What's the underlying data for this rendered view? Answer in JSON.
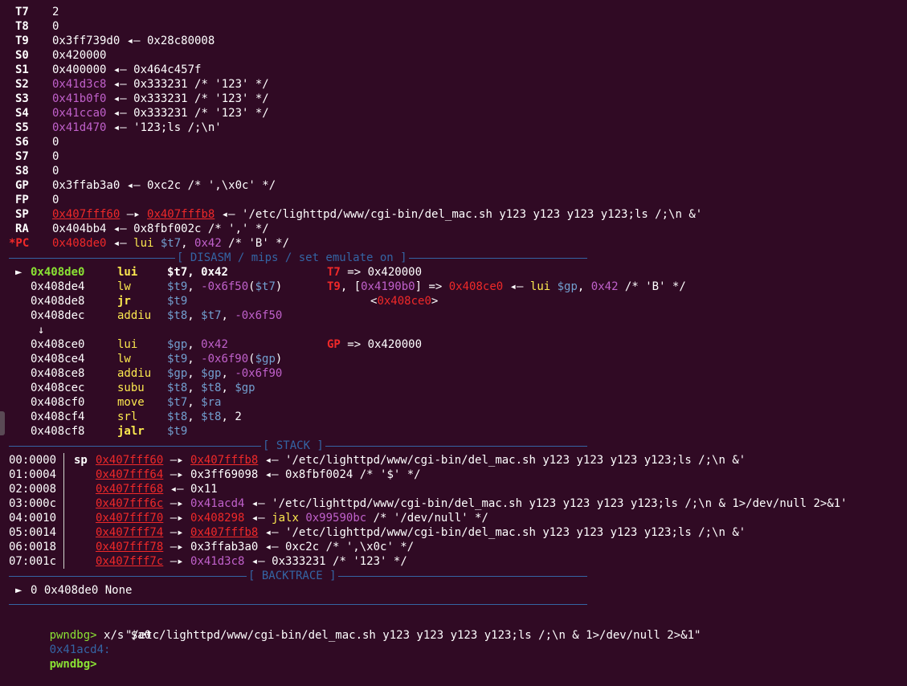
{
  "registers": [
    {
      "name": "T7",
      "parts": [
        [
          "w",
          "2"
        ]
      ]
    },
    {
      "name": "T8",
      "parts": [
        [
          "w",
          "0"
        ]
      ]
    },
    {
      "name": "T9",
      "parts": [
        [
          "w",
          "0x3ff739d0 ◂— 0x28c80008"
        ]
      ]
    },
    {
      "name": "S0",
      "parts": [
        [
          "w",
          "0x420000"
        ]
      ]
    },
    {
      "name": "S1",
      "parts": [
        [
          "w",
          "0x400000 ◂— 0x464c457f"
        ]
      ]
    },
    {
      "name": "S2",
      "parts": [
        [
          "m",
          "0x41d3c8"
        ],
        [
          "w",
          " ◂— 0x333231 /* '123' */"
        ]
      ]
    },
    {
      "name": "S3",
      "parts": [
        [
          "m",
          "0x41b0f0"
        ],
        [
          "w",
          " ◂— 0x333231 /* '123' */"
        ]
      ]
    },
    {
      "name": "S4",
      "parts": [
        [
          "m",
          "0x41cca0"
        ],
        [
          "w",
          " ◂— 0x333231 /* '123' */"
        ]
      ]
    },
    {
      "name": "S5",
      "parts": [
        [
          "m",
          "0x41d470"
        ],
        [
          "w",
          " ◂— '123;ls /;\\n'"
        ]
      ]
    },
    {
      "name": "S6",
      "parts": [
        [
          "w",
          "0"
        ]
      ]
    },
    {
      "name": "S7",
      "parts": [
        [
          "w",
          "0"
        ]
      ]
    },
    {
      "name": "S8",
      "parts": [
        [
          "w",
          "0"
        ]
      ]
    },
    {
      "name": "GP",
      "parts": [
        [
          "w",
          "0x3ffab3a0 ◂— 0xc2c /* ',\\x0c' */"
        ]
      ]
    },
    {
      "name": "FP",
      "parts": [
        [
          "w",
          "0"
        ]
      ]
    },
    {
      "name": "SP",
      "parts": [
        [
          "ru",
          "0x407fff60"
        ],
        [
          "w",
          " —▸ "
        ],
        [
          "ru",
          "0x407fffb8"
        ],
        [
          "w",
          " ◂— '/etc/lighttpd/www/cgi-bin/del_mac.sh y123 y123 y123 y123;ls /;\\n &'"
        ]
      ]
    },
    {
      "name": "RA",
      "parts": [
        [
          "w",
          "0x404bb4 ◂— 0x8fbf002c /* ',' */"
        ]
      ]
    },
    {
      "name": "*PC",
      "changed": true,
      "parts": [
        [
          "r",
          "0x408de0"
        ],
        [
          "w",
          " ◂— "
        ],
        [
          "y",
          "lui "
        ],
        [
          "b",
          "$t7"
        ],
        [
          "w",
          ", "
        ],
        [
          "m",
          "0x42"
        ],
        [
          "w",
          " /* 'B' */"
        ]
      ]
    }
  ],
  "sections": {
    "disasm": "[ DISASM / mips / set emulate on ]",
    "stack": "[ STACK ]",
    "backtrace": "[ BACKTRACE ]"
  },
  "disasm": {
    "current_marker": "►",
    "branch_arrow": "↓",
    "rows": [
      {
        "current": true,
        "addr": "0x408de0",
        "mnem": "lui",
        "ops": [
          [
            "wb",
            "$t7"
          ],
          [
            "wb",
            ", "
          ],
          [
            "wb",
            "0x42"
          ]
        ],
        "note": [
          [
            "rb",
            "T7"
          ],
          [
            "w",
            " => 0x420000"
          ]
        ]
      },
      {
        "addr": "0x408de4",
        "mnem": "lw",
        "ops": [
          [
            "b",
            "$t9"
          ],
          [
            "w",
            ", "
          ],
          [
            "m",
            "-0x6f50"
          ],
          [
            "w",
            "("
          ],
          [
            "b",
            "$t7"
          ],
          [
            "w",
            ")"
          ]
        ],
        "note": [
          [
            "rb",
            "T9"
          ],
          [
            "w",
            ", ["
          ],
          [
            "m",
            "0x4190b0"
          ],
          [
            "w",
            "] => "
          ],
          [
            "r",
            "0x408ce0"
          ],
          [
            "w",
            " ◂— "
          ],
          [
            "y",
            "lui "
          ],
          [
            "b",
            "$gp"
          ],
          [
            "w",
            ", "
          ],
          [
            "m",
            "0x42"
          ],
          [
            "w",
            " /* 'B' */"
          ]
        ]
      },
      {
        "addr": "0x408de8",
        "mnem": "jr",
        "bold": true,
        "ops": [
          [
            "b",
            "$t9"
          ]
        ],
        "note": [
          [
            "w",
            "<"
          ],
          [
            "r",
            "0x408ce0"
          ],
          [
            "w",
            ">"
          ]
        ]
      },
      {
        "addr": "0x408dec",
        "mnem": "addiu",
        "ops": [
          [
            "b",
            "$t8"
          ],
          [
            "w",
            ", "
          ],
          [
            "b",
            "$t7"
          ],
          [
            "w",
            ", "
          ],
          [
            "m",
            "-0x6f50"
          ]
        ]
      },
      {
        "addr": "0x408ce0",
        "mnem": "lui",
        "ops": [
          [
            "b",
            "$gp"
          ],
          [
            "w",
            ", "
          ],
          [
            "m",
            "0x42"
          ]
        ],
        "note": [
          [
            "rb",
            "GP"
          ],
          [
            "w",
            " => 0x420000"
          ]
        ]
      },
      {
        "addr": "0x408ce4",
        "mnem": "lw",
        "ops": [
          [
            "b",
            "$t9"
          ],
          [
            "w",
            ", "
          ],
          [
            "m",
            "-0x6f90"
          ],
          [
            "w",
            "("
          ],
          [
            "b",
            "$gp"
          ],
          [
            "w",
            ")"
          ]
        ]
      },
      {
        "addr": "0x408ce8",
        "mnem": "addiu",
        "ops": [
          [
            "b",
            "$gp"
          ],
          [
            "w",
            ", "
          ],
          [
            "b",
            "$gp"
          ],
          [
            "w",
            ", "
          ],
          [
            "m",
            "-0x6f90"
          ]
        ]
      },
      {
        "addr": "0x408cec",
        "mnem": "subu",
        "ops": [
          [
            "b",
            "$t8"
          ],
          [
            "w",
            ", "
          ],
          [
            "b",
            "$t8"
          ],
          [
            "w",
            ", "
          ],
          [
            "b",
            "$gp"
          ]
        ]
      },
      {
        "addr": "0x408cf0",
        "mnem": "move",
        "ops": [
          [
            "b",
            "$t7"
          ],
          [
            "w",
            ", "
          ],
          [
            "b",
            "$ra"
          ]
        ]
      },
      {
        "addr": "0x408cf4",
        "mnem": "srl",
        "ops": [
          [
            "b",
            "$t8"
          ],
          [
            "w",
            ", "
          ],
          [
            "b",
            "$t8"
          ],
          [
            "w",
            ", "
          ],
          [
            "w",
            "2"
          ]
        ]
      },
      {
        "addr": "0x408cf8",
        "mnem": "jalr",
        "bold": true,
        "ops": [
          [
            "b",
            "$t9"
          ]
        ]
      }
    ]
  },
  "stack": [
    {
      "idx": "00:0000",
      "tag": "sp",
      "parts": [
        [
          "ru",
          "0x407fff60"
        ],
        [
          "w",
          " —▸ "
        ],
        [
          "ru",
          "0x407fffb8"
        ],
        [
          "w",
          " ◂— '/etc/lighttpd/www/cgi-bin/del_mac.sh y123 y123 y123 y123;ls /;\\n &'"
        ]
      ]
    },
    {
      "idx": "01:0004",
      "tag": "",
      "parts": [
        [
          "ru",
          "0x407fff64"
        ],
        [
          "w",
          " —▸ 0x3ff69098 ◂— 0x8fbf0024 /* '$' */"
        ]
      ]
    },
    {
      "idx": "02:0008",
      "tag": "",
      "parts": [
        [
          "ru",
          "0x407fff68"
        ],
        [
          "w",
          " ◂— 0x11"
        ]
      ]
    },
    {
      "idx": "03:000c",
      "tag": "",
      "parts": [
        [
          "ru",
          "0x407fff6c"
        ],
        [
          "w",
          " —▸ "
        ],
        [
          "m",
          "0x41acd4"
        ],
        [
          "w",
          " ◂— '/etc/lighttpd/www/cgi-bin/del_mac.sh y123 y123 y123 y123;ls /;\\n & 1>/dev/null 2>&1'"
        ]
      ]
    },
    {
      "idx": "04:0010",
      "tag": "",
      "parts": [
        [
          "ru",
          "0x407fff70"
        ],
        [
          "w",
          " —▸ "
        ],
        [
          "r",
          "0x408298"
        ],
        [
          "w",
          " ◂— "
        ],
        [
          "y",
          "jalx "
        ],
        [
          "m",
          "0x99590bc"
        ],
        [
          "w",
          " /* '/dev/null' */"
        ]
      ]
    },
    {
      "idx": "05:0014",
      "tag": "",
      "parts": [
        [
          "ru",
          "0x407fff74"
        ],
        [
          "w",
          " —▸ "
        ],
        [
          "ru",
          "0x407fffb8"
        ],
        [
          "w",
          " ◂— '/etc/lighttpd/www/cgi-bin/del_mac.sh y123 y123 y123 y123;ls /;\\n &'"
        ]
      ]
    },
    {
      "idx": "06:0018",
      "tag": "",
      "parts": [
        [
          "ru",
          "0x407fff78"
        ],
        [
          "w",
          " —▸ 0x3ffab3a0 ◂— 0xc2c /* ',\\x0c' */"
        ]
      ]
    },
    {
      "idx": "07:001c",
      "tag": "",
      "parts": [
        [
          "ru",
          "0x407fff7c"
        ],
        [
          "w",
          " —▸ "
        ],
        [
          "m",
          "0x41d3c8"
        ],
        [
          "w",
          " ◂— 0x333231 /* '123' */"
        ]
      ]
    }
  ],
  "backtrace": {
    "marker": "►",
    "text": "0 0x408de0 None"
  },
  "console": {
    "prompt": "pwndbg>",
    "command": "x/s $a0",
    "result_addr": "0x41acd4:",
    "result_value": "\"/etc/lighttpd/www/cgi-bin/del_mac.sh y123 y123 y123 y123;ls /;\\n & 1>/dev/null 2>&1\""
  },
  "colors": {
    "background": "#300a24",
    "separator": "#3465a4",
    "address_heap": "#c061cb",
    "address_code": "#ef2929",
    "mnemonic": "#fce94f",
    "register": "#729fcf",
    "prompt": "#8ae234"
  }
}
